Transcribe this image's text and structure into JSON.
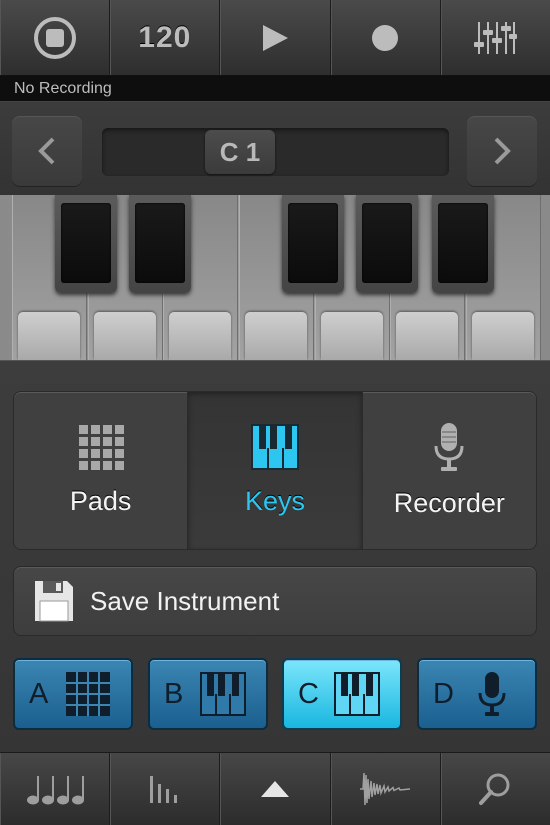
{
  "transport": {
    "tempo": "120",
    "status": "No Recording"
  },
  "octave": {
    "current": "C 1"
  },
  "modes": [
    {
      "label": "Pads",
      "icon": "grid-icon",
      "selected": false
    },
    {
      "label": "Keys",
      "icon": "piano-icon",
      "selected": true
    },
    {
      "label": "Recorder",
      "icon": "microphone-icon",
      "selected": false
    }
  ],
  "save": {
    "label": "Save Instrument"
  },
  "slots": [
    {
      "letter": "A",
      "icon": "grid-icon",
      "active": false
    },
    {
      "letter": "B",
      "icon": "piano-icon",
      "active": false
    },
    {
      "letter": "C",
      "icon": "piano-icon",
      "active": true
    },
    {
      "letter": "D",
      "icon": "microphone-icon",
      "active": false
    }
  ],
  "colors": {
    "accent": "#2cc6f0",
    "slot_blue": "#2a73a3",
    "slot_active": "#3fd0f2"
  }
}
